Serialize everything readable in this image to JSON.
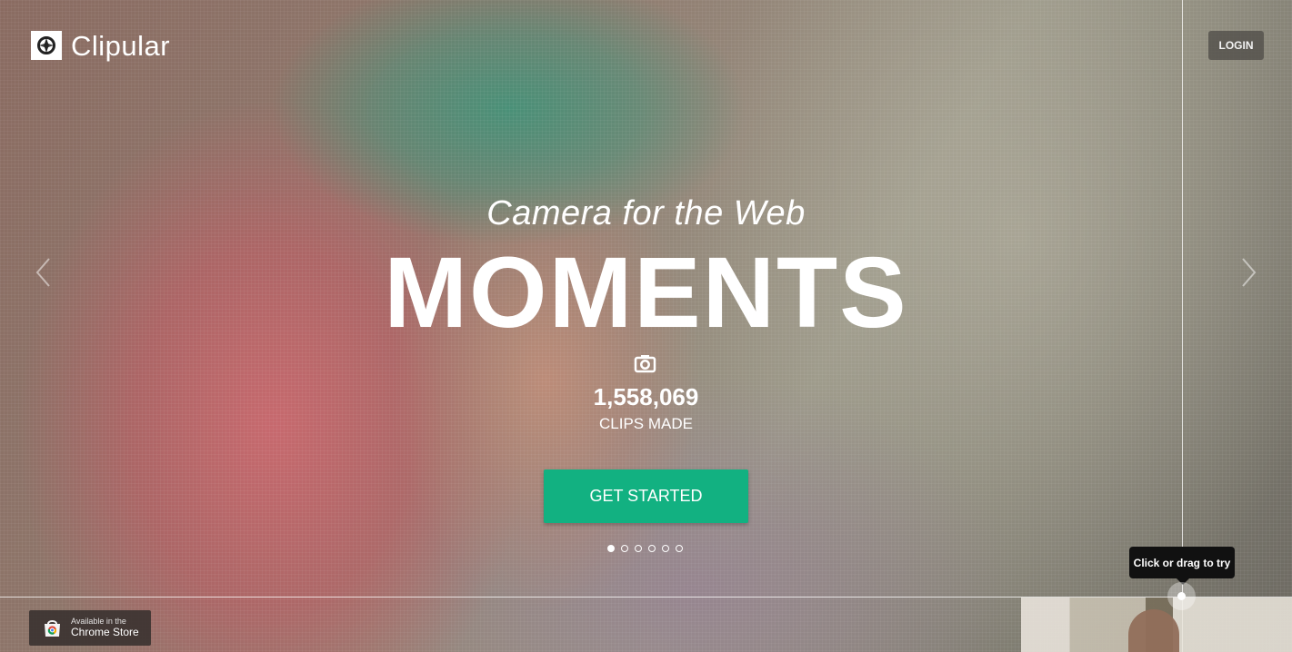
{
  "brand": {
    "name": "Clipular"
  },
  "header": {
    "login_label": "LOGIN"
  },
  "hero": {
    "tagline": "Camera for the Web",
    "headline": "MOMENTS",
    "counter": {
      "value": "1,558,069",
      "label": "CLIPS MADE"
    },
    "cta_label": "GET STARTED",
    "slides": {
      "count": 6,
      "active_index": 0
    }
  },
  "tooltip": {
    "text": "Click or drag to try"
  },
  "store_badge": {
    "small_text": "Available in the",
    "large_text": "Chrome Store"
  },
  "icons": {
    "logo": "camera-aperture-icon",
    "counter": "camera-icon",
    "prev": "chevron-left-icon",
    "next": "chevron-right-icon",
    "store": "chrome-store-icon"
  },
  "colors": {
    "cta": "#12b181",
    "tooltip": "#111111",
    "login_bg": "#4b4844"
  }
}
